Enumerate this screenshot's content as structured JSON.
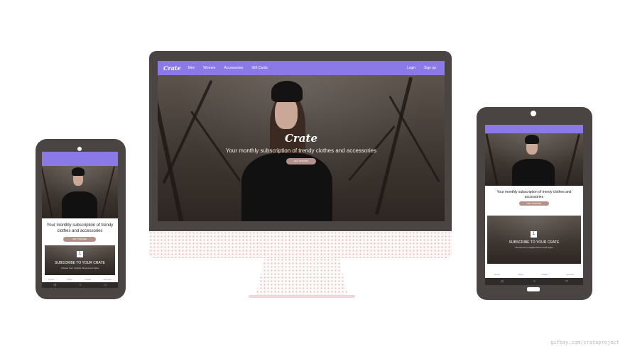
{
  "brand": "Crate",
  "tagline": "Your monthly subscription of trendy clothes and accessories",
  "cta_label": "GET STARTED",
  "desktop_nav": {
    "links": [
      "Men",
      "Women",
      "Accessories",
      "Gift Cards"
    ],
    "right_links": [
      "Login",
      "Sign up"
    ]
  },
  "step": {
    "number": "1",
    "title": "SUBSCRIBE TO YOUR CRATE",
    "subtitle": "Choose from multiple themes and styles"
  },
  "mobile_tabs": [
    "Home",
    "Shop",
    "Crates",
    "Account"
  ],
  "watermark": "gifbay.com/crateproject",
  "colors": {
    "accent": "#8c79e8",
    "device_frame": "#4a4543",
    "button": "#b3918c"
  }
}
